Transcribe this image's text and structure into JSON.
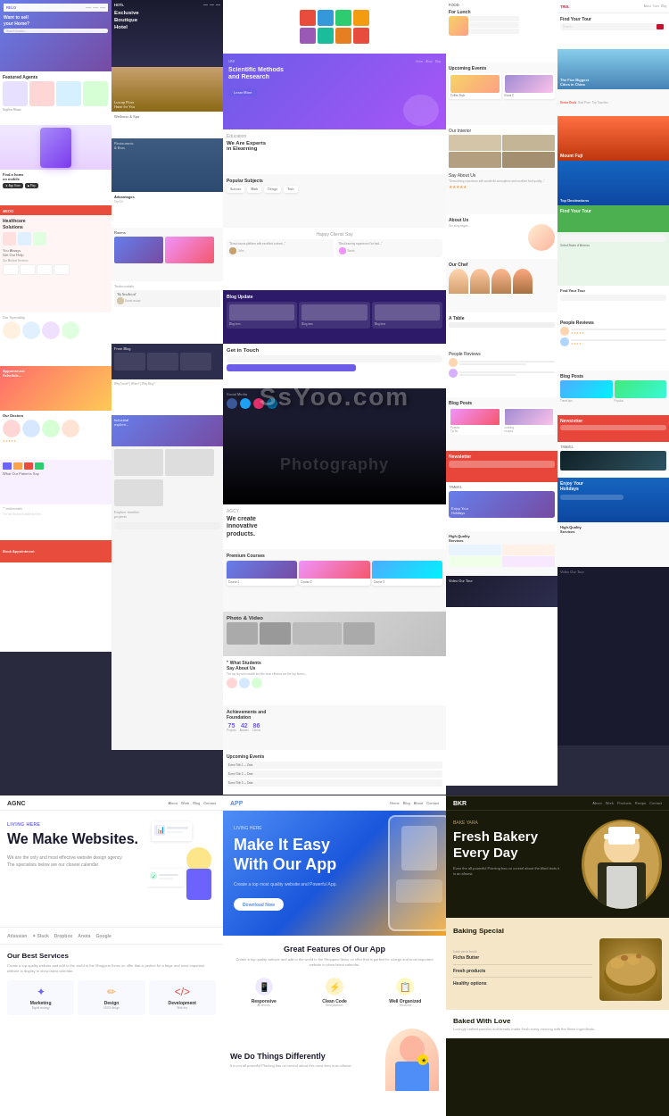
{
  "watermark": "SsYoo.com",
  "top": {
    "description": "Collage of website templates"
  },
  "bottom": {
    "templates": [
      {
        "id": "agnc",
        "logo": "AGNC",
        "nav": [
          "About",
          "Work",
          "Blog",
          "Contact"
        ],
        "badge": "LIVING HERE",
        "title": "We Make Websites.",
        "description": "We are the only and most effective website design agency. The specialists below are our closest calendar.",
        "brands": [
          "Atlassian",
          "Slack",
          "Dropbox",
          "Anota",
          "Google"
        ],
        "services_title": "Our Best Services",
        "services_desc": "Create a top quality website and add to the world to the Shoppers Items on offer that is perfect for a large and most important website to display to show latest calendar.",
        "services": [
          {
            "icon": "✦",
            "name": "Marketing",
            "color": "#6c63ff"
          },
          {
            "icon": "✏",
            "name": "Design",
            "color": "#f7a44d"
          },
          {
            "icon": "</>",
            "name": "Development",
            "color": "#e74c3c"
          }
        ]
      },
      {
        "id": "app",
        "logo": "APP",
        "nav": [
          "Home",
          "Blog",
          "About",
          "Contact"
        ],
        "hero_badge": "LIVING HERE",
        "hero_title": "Make It Easy With Our App",
        "hero_desc": "Create a top most quality website and Powerful App.",
        "hero_btn": "Download Now",
        "features_title": "Great Features Of Our App",
        "features_desc": "Create a top quality website and add to the world to the Shoppers Items on offer that is perfect for a large and most important website to show latest calendar.",
        "features": [
          {
            "icon": "📱",
            "name": "Responsive",
            "color": "#6c63ff",
            "bg": "#ede9fe"
          },
          {
            "icon": "⚡",
            "name": "Clean Code",
            "color": "#f7a44d",
            "bg": "#fef3c7"
          },
          {
            "icon": "📋",
            "name": "Well Organized",
            "color": "#f59e0b",
            "bg": "#fef9c3"
          }
        ],
        "diff_title": "We Do Things Differently",
        "diff_desc": "It is not all powerful Planting has no control about this most item is an almost."
      },
      {
        "id": "bkr",
        "logo": "BKR",
        "nav": [
          "About",
          "Work",
          "Products",
          "Recipe",
          "Contact"
        ],
        "hero_badge": "BAKE YARA",
        "hero_title": "Fresh Bakery Every Day",
        "hero_desc": "Even the all-powerful Pointing has no control about the blind texts it is an almost.",
        "about_title": "Baking Special",
        "about_details": [
          {
            "label": "Last wine back",
            "value": "Ficha Butter"
          },
          {
            "label": "",
            "value": "Fresh products"
          },
          {
            "label": "",
            "value": "Healthy options"
          }
        ],
        "baked_title": "Baked With Love",
        "baked_desc": ""
      }
    ]
  }
}
